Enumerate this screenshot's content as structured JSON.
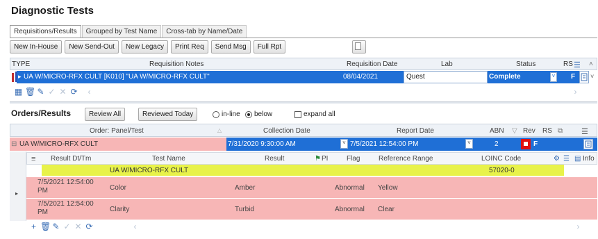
{
  "page": {
    "title": "Diagnostic Tests"
  },
  "tabs": [
    "Requisitions/Results",
    "Grouped by Test Name",
    "Cross-tab by Name/Date"
  ],
  "toolbar": {
    "buttons": [
      "New In-House",
      "New Send-Out",
      "New Legacy",
      "Print Req",
      "Send Msg",
      "Full Rpt"
    ]
  },
  "requisitions": {
    "headers": {
      "type": "TYPE",
      "notes": "Requisition Notes",
      "date": "Requisition Date",
      "lab": "Lab",
      "status": "Status",
      "rs": "RS"
    },
    "row": {
      "notes": "UA W/MICRO-RFX CULT [K010] \"UA W/MICRO-RFX CULT\"",
      "date": "08/04/2021",
      "lab": "Quest",
      "status": "Complete",
      "rs": "F"
    }
  },
  "orders": {
    "title": "Orders/Results",
    "review_all": "Review All",
    "reviewed_today": "Reviewed Today",
    "inline_label": "in-line",
    "below_label": "below",
    "expand_label": "expand all",
    "headers": {
      "panel": "Order: Panel/Test",
      "collection": "Collection Date",
      "report": "Report Date",
      "abn": "ABN",
      "rev": "Rev",
      "rs": "RS"
    },
    "row": {
      "panel": "UA W/MICRO-RFX CULT",
      "collection": "7/31/2020 9:30:00 AM",
      "report": "7/5/2021 12:54:00 PM",
      "abn": "2",
      "rs": "F"
    }
  },
  "results": {
    "headers": {
      "dttm": "Result Dt/Tm",
      "test": "Test Name",
      "result": "Result",
      "pi": "PI",
      "flag": "Flag",
      "range": "Reference Range",
      "loinc": "LOINC Code",
      "info": "Info"
    },
    "highlight_row": {
      "test": "UA W/MICRO-RFX CULT",
      "loinc": "57020-0"
    },
    "rows": [
      {
        "dttm_1": "7/5/2021 12:54:00",
        "dttm_2": "PM",
        "test": "Color",
        "result": "Amber",
        "flag": "Abnormal",
        "range": "Yellow"
      },
      {
        "dttm_1": "7/5/2021 12:54:00",
        "dttm_2": "PM",
        "test": "Clarity",
        "result": "Turbid",
        "flag": "Abnormal",
        "range": "Clear"
      }
    ]
  },
  "colors": {
    "selection": "#1f6fd6",
    "abnormal_row": "#f7b6b6",
    "highlight": "#e8f24a",
    "rev_flag": "#e01010"
  }
}
